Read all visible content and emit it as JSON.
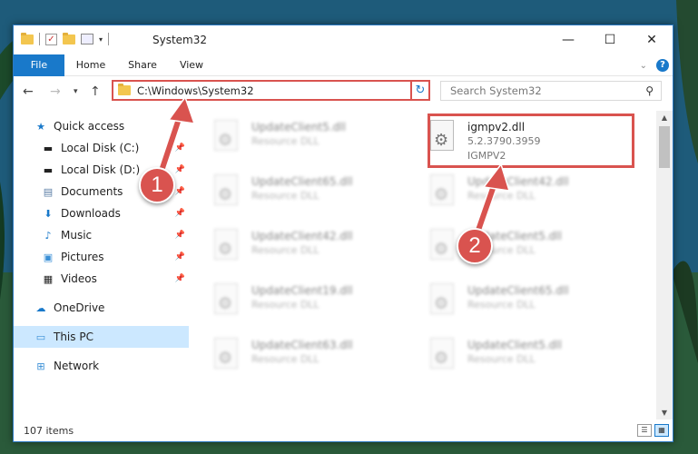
{
  "window": {
    "title": "System32"
  },
  "titlebar": {
    "minimize_icon": "minimize-icon",
    "maximize_icon": "maximize-icon",
    "close_icon": "close-icon"
  },
  "ribbon": {
    "tabs": [
      {
        "label": "File"
      },
      {
        "label": "Home"
      },
      {
        "label": "Share"
      },
      {
        "label": "View"
      }
    ]
  },
  "navbar": {
    "address": "C:\\Windows\\System32",
    "search_placeholder": "Search System32"
  },
  "sidebar": {
    "items": [
      {
        "label": "Quick access",
        "icon": "star-icon"
      },
      {
        "label": "Local Disk (C:)",
        "icon": "disk-icon",
        "pinned": true
      },
      {
        "label": "Local Disk (D:)",
        "icon": "disk-icon",
        "pinned": true
      },
      {
        "label": "Documents",
        "icon": "documents-icon",
        "pinned": true
      },
      {
        "label": "Downloads",
        "icon": "downloads-icon",
        "pinned": true
      },
      {
        "label": "Music",
        "icon": "music-icon",
        "pinned": true
      },
      {
        "label": "Pictures",
        "icon": "pictures-icon",
        "pinned": true
      },
      {
        "label": "Videos",
        "icon": "videos-icon",
        "pinned": true
      },
      {
        "label": "OneDrive",
        "icon": "onedrive-icon"
      },
      {
        "label": "This PC",
        "icon": "pc-icon",
        "selected": true
      },
      {
        "label": "Network",
        "icon": "network-icon"
      }
    ]
  },
  "files": [
    {
      "name": "UpdateClient5.dll",
      "type": "Resource DLL"
    },
    {
      "name": "igmpv2.dll",
      "version": "5.2.3790.3959",
      "type": "IGMPV2"
    },
    {
      "name": "UpdateClient65.dll",
      "type": "Resource DLL"
    },
    {
      "name": "UpdateClient42.dll",
      "type": "Resource DLL"
    },
    {
      "name": "UpdateClient42.dll",
      "type": "Resource DLL"
    },
    {
      "name": "UpdateClient5.dll",
      "type": "Resource DLL"
    },
    {
      "name": "UpdateClient19.dll",
      "type": "Resource DLL"
    },
    {
      "name": "UpdateClient65.dll",
      "type": "Resource DLL"
    },
    {
      "name": "UpdateClient63.dll",
      "type": "Resource DLL"
    },
    {
      "name": "UpdateClient5.dll",
      "type": "Resource DLL"
    }
  ],
  "status": {
    "item_count": "107 items"
  },
  "annotations": {
    "step1": "1",
    "step2": "2",
    "color": "#d9534f"
  }
}
